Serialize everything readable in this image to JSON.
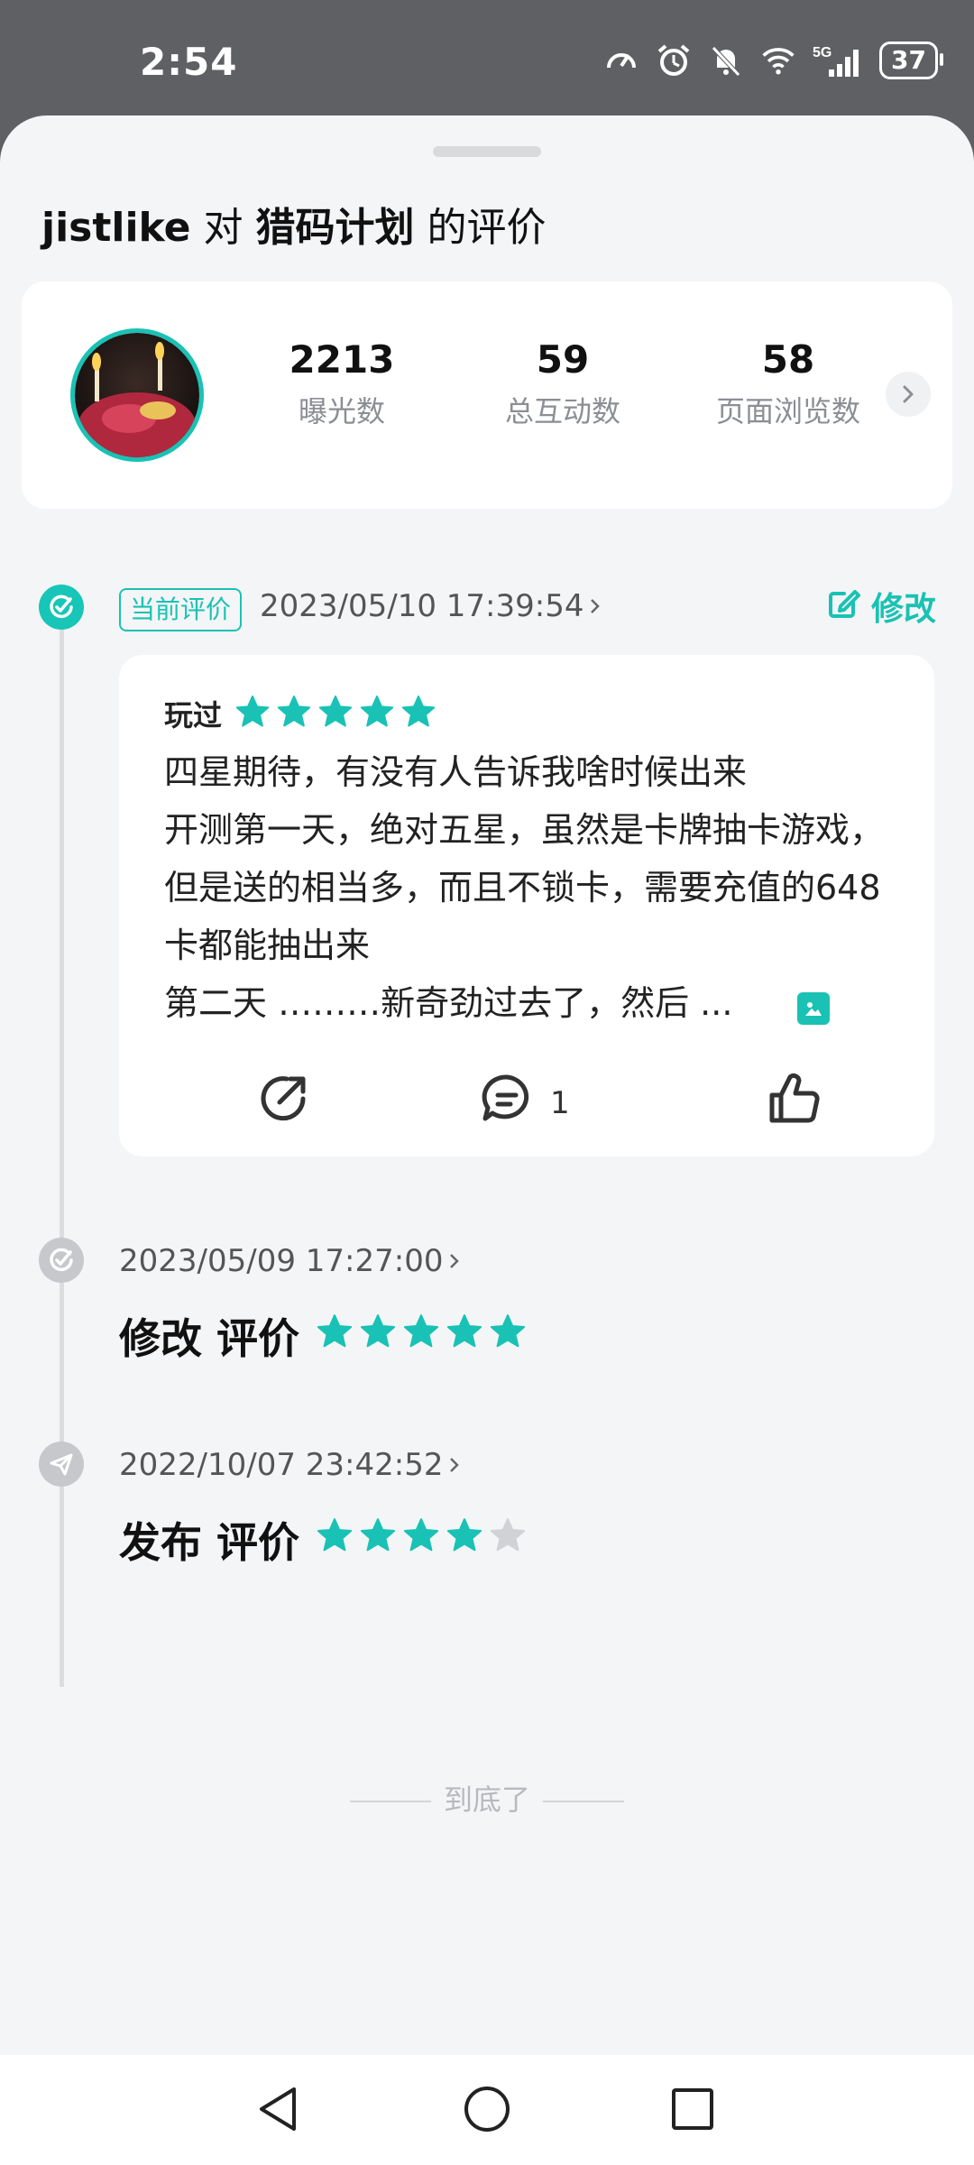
{
  "status_bar": {
    "time": "2:54",
    "battery": "37",
    "network": "5G"
  },
  "sheet": {
    "title": {
      "user": "jistlike",
      "connector": "对",
      "game": "猎码计划",
      "suffix": "的评价"
    }
  },
  "stats": [
    {
      "value": "2213",
      "label": "曝光数"
    },
    {
      "value": "59",
      "label": "总互动数"
    },
    {
      "value": "58",
      "label": "页面浏览数"
    }
  ],
  "current_review": {
    "tag": "当前评价",
    "date": "2023/05/10 17:39:54",
    "edit_label": "修改",
    "played_label": "玩过",
    "rating": 5,
    "text": "四星期待，有没有人告诉我啥时候出来\n开测第一天，绝对五星，虽然是卡牌抽卡游戏，但是送的相当多，而且不锁卡，需要充值的648卡都能抽出来\n第二天 ………新奇劲过去了，然后 ...",
    "comment_count": "1"
  },
  "history": [
    {
      "date": "2023/05/09 17:27:00",
      "action": "修改",
      "noun": "评价",
      "rating": 5
    },
    {
      "date": "2022/10/07 23:42:52",
      "action": "发布",
      "noun": "评价",
      "rating": 4
    }
  ],
  "footer_note": "到底了",
  "colors": {
    "accent": "#19c2b4",
    "star_empty": "#d0d2d6"
  }
}
